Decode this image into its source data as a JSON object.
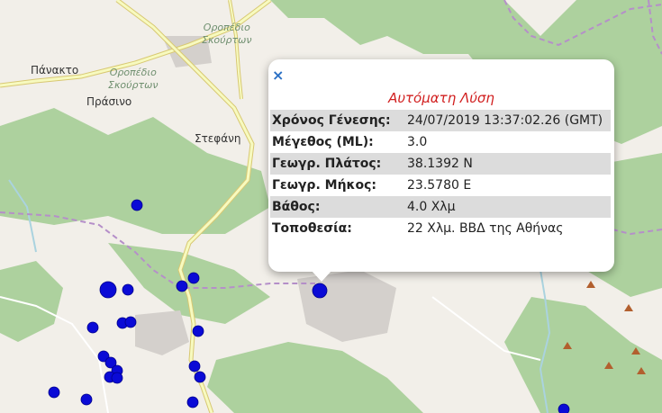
{
  "map": {
    "labels": {
      "panakto": "Πάνακτο",
      "prasino": "Πράσινο",
      "stefani": "Στεφάνη",
      "oropedio_top": "Οροπέδιο\nΣκούρτων",
      "oropedio_left": "Οροπέδιο\nΣκούρτων"
    },
    "colors": {
      "background": "#f2efe9",
      "forest": "#add19e",
      "road_primary": "#f7fabf",
      "boundary": "#b58fc9",
      "river": "#aad3df",
      "quake_marker": "#0a0ad6"
    },
    "markers": [
      {
        "name": "epicenter-marker",
        "kind": "highlighted"
      },
      {
        "name": "quake-marker",
        "kind": "past"
      }
    ]
  },
  "popup": {
    "close_label": "×",
    "title": "Αυτόματη Λύση",
    "rows": [
      {
        "label": "Χρόνος Γένεσης:",
        "value": "24/07/2019 13:37:02.26 (GMT)"
      },
      {
        "label": "Μέγεθος (ML):",
        "value": "3.0"
      },
      {
        "label": "Γεωγρ. Πλάτος:",
        "value": "38.1392 N"
      },
      {
        "label": "Γεωγρ. Μήκος:",
        "value": "23.5780 E"
      },
      {
        "label": "Βάθος:",
        "value": "4.0 Χλμ"
      },
      {
        "label": "Τοποθεσία:",
        "value": "22 Χλμ. ΒΒΔ της Αθήνας"
      }
    ]
  }
}
